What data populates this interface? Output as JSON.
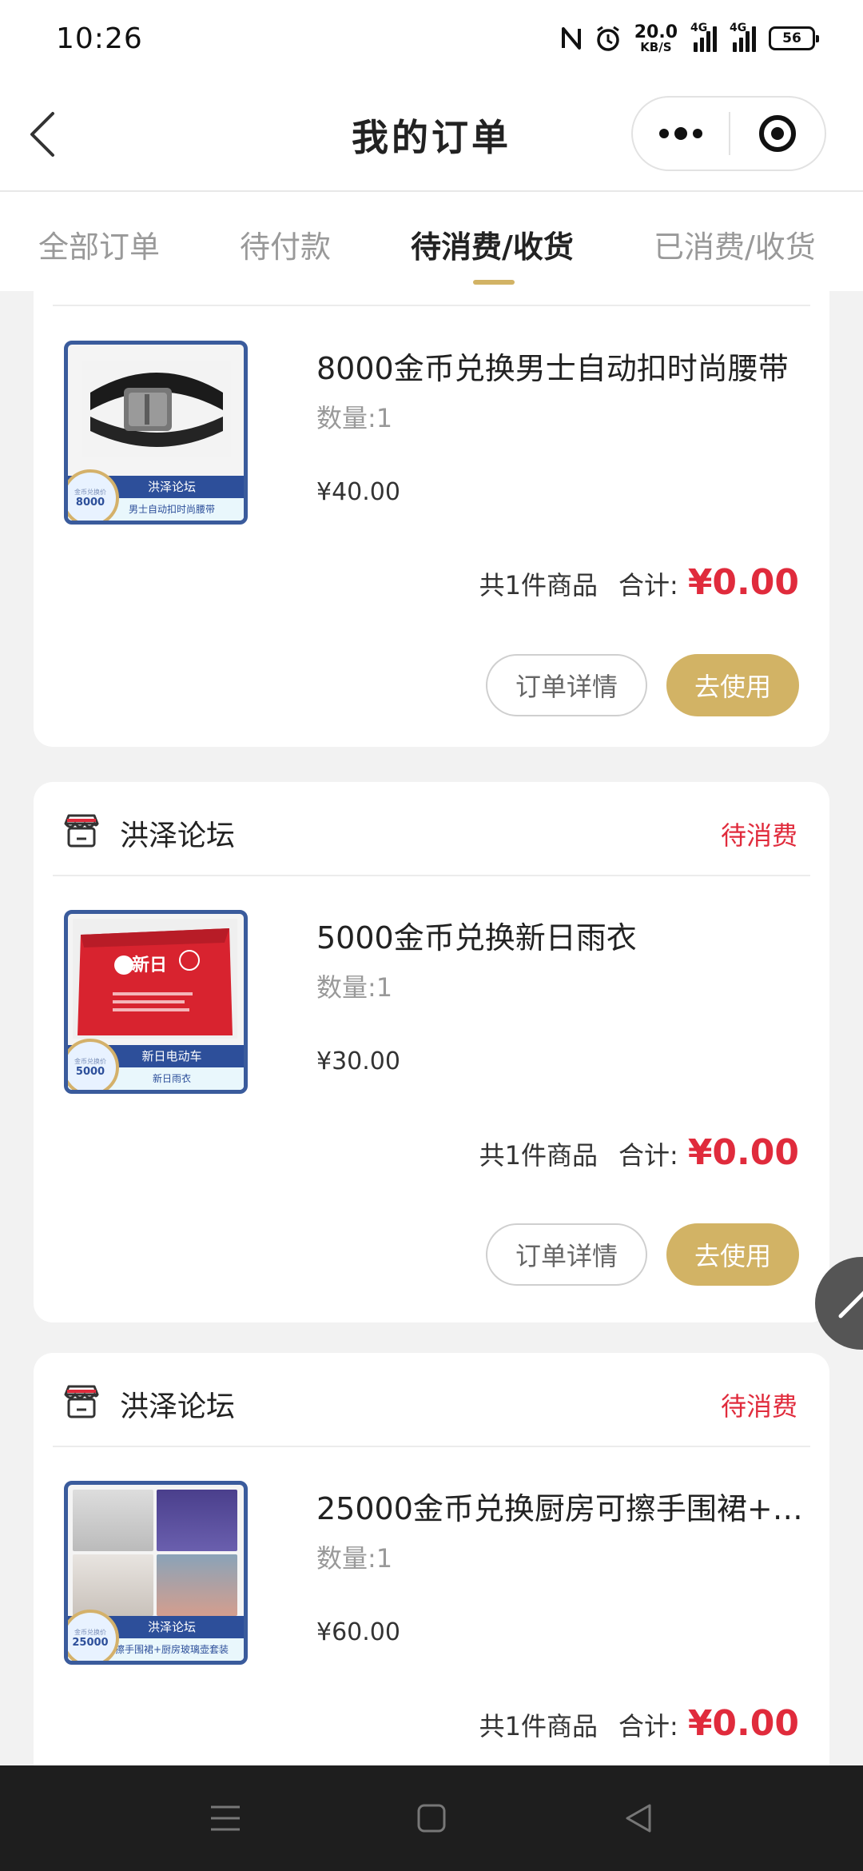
{
  "status_bar": {
    "time": "10:26",
    "speed_value": "20.0",
    "speed_unit": "KB/S",
    "net1": "4G",
    "net2": "4G",
    "battery": "56"
  },
  "nav": {
    "title": "我的订单"
  },
  "tabs": [
    {
      "label": "全部订单",
      "active": false
    },
    {
      "label": "待付款",
      "active": false
    },
    {
      "label": "待消费/收货",
      "active": true
    },
    {
      "label": "已消费/收货",
      "active": false
    }
  ],
  "orders": [
    {
      "shop_name": "",
      "status": "",
      "product": {
        "title": "8000金币兑换男士自动扣时尚腰带",
        "qty": "数量:1",
        "price": "¥40.00",
        "thumb_line1": "洪泽论坛",
        "thumb_line2": "男士自动扣时尚腰带",
        "coin_small": "金币兑换价",
        "coin": "8000"
      },
      "summary": {
        "count": "共1件商品",
        "total_label": "合计:",
        "total": "¥0.00"
      },
      "buttons": {
        "detail": "订单详情",
        "use": "去使用"
      }
    },
    {
      "shop_name": "洪泽论坛",
      "status": "待消费",
      "product": {
        "title": "5000金币兑换新日雨衣",
        "qty": "数量:1",
        "price": "¥30.00",
        "thumb_line1": "新日电动车",
        "thumb_line2": "新日雨衣",
        "coin_small": "金币兑换价",
        "coin": "5000",
        "brand": "新日"
      },
      "summary": {
        "count": "共1件商品",
        "total_label": "合计:",
        "total": "¥0.00"
      },
      "buttons": {
        "detail": "订单详情",
        "use": "去使用"
      }
    },
    {
      "shop_name": "洪泽论坛",
      "status": "待消费",
      "product": {
        "title": "25000金币兑换厨房可擦手围裙+ …",
        "qty": "数量:1",
        "price": "¥60.00",
        "thumb_line1": "洪泽论坛",
        "thumb_line2": "擦手围裙+厨房玻璃壶套装",
        "coin_small": "金币兑换价",
        "coin": "25000"
      },
      "summary": {
        "count": "共1件商品",
        "total_label": "合计:",
        "total": "¥0.00"
      }
    }
  ],
  "colors": {
    "accent": "#d2b365",
    "price_red": "#e02b3c",
    "thumb_blue": "#2d4f9a"
  },
  "icons": [
    "back-icon",
    "more-icon",
    "close-target-icon",
    "shop-icon",
    "back-to-top-icon",
    "menu-icon",
    "home-icon",
    "back-triangle-icon"
  ]
}
